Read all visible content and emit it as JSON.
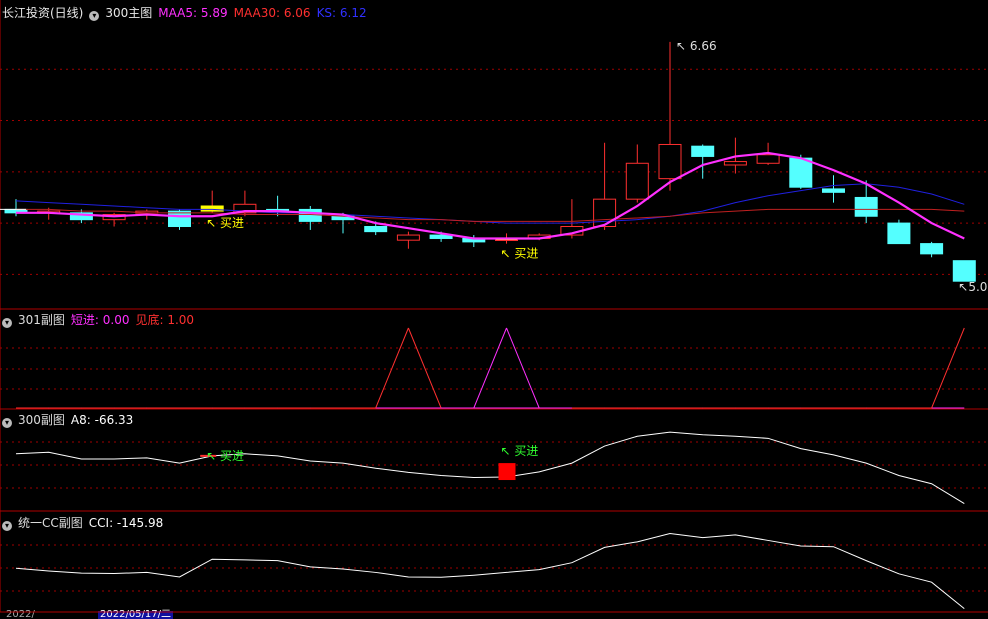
{
  "header": {
    "stock": "长江投资(日线)",
    "main_label": "300主图",
    "maa5": "MAA5: 5.89",
    "maa30": "MAA30: 6.06",
    "ks": "KS: 6.12"
  },
  "pane2": {
    "name": "301副图",
    "s1": "短进: 0.00",
    "s2": "见底: 1.00"
  },
  "pane3": {
    "name": "300副图",
    "s1": "A8: -66.33"
  },
  "pane4": {
    "name": "统一CC副图",
    "s1": "CCI: -145.98"
  },
  "bottom": {
    "left": "2022/",
    "date": "2022/05/17/二"
  },
  "colors": {
    "up": "#ff3030",
    "down": "#54ffff",
    "maa5": "#ff30ff",
    "maa30": "#c02020",
    "ks": "#2020e0",
    "grid": "#a00000",
    "yellow": "#ffff00"
  },
  "chart_data": [
    {
      "type": "candlestick",
      "title": "长江投资(日线)",
      "candles": [
        {
          "o": 5.68,
          "h": 5.74,
          "l": 5.64,
          "c": 5.66
        },
        {
          "o": 5.67,
          "h": 5.69,
          "l": 5.62,
          "c": 5.67
        },
        {
          "o": 5.66,
          "h": 5.68,
          "l": 5.6,
          "c": 5.62
        },
        {
          "o": 5.62,
          "h": 5.66,
          "l": 5.58,
          "c": 5.65
        },
        {
          "o": 5.66,
          "h": 5.68,
          "l": 5.62,
          "c": 5.67
        },
        {
          "o": 5.67,
          "h": 5.68,
          "l": 5.56,
          "c": 5.58
        },
        {
          "o": 5.67,
          "h": 5.79,
          "l": 5.66,
          "c": 5.7
        },
        {
          "o": 5.66,
          "h": 5.79,
          "l": 5.64,
          "c": 5.71
        },
        {
          "o": 5.68,
          "h": 5.76,
          "l": 5.64,
          "c": 5.67
        },
        {
          "o": 5.68,
          "h": 5.7,
          "l": 5.56,
          "c": 5.61
        },
        {
          "o": 5.64,
          "h": 5.66,
          "l": 5.54,
          "c": 5.62
        },
        {
          "o": 5.58,
          "h": 5.61,
          "l": 5.53,
          "c": 5.55
        },
        {
          "o": 5.5,
          "h": 5.55,
          "l": 5.45,
          "c": 5.53
        },
        {
          "o": 5.53,
          "h": 5.55,
          "l": 5.49,
          "c": 5.51
        },
        {
          "o": 5.51,
          "h": 5.53,
          "l": 5.46,
          "c": 5.49
        },
        {
          "o": 5.5,
          "h": 5.54,
          "l": 5.48,
          "c": 5.51
        },
        {
          "o": 5.51,
          "h": 5.54,
          "l": 5.5,
          "c": 5.53
        },
        {
          "o": 5.53,
          "h": 5.74,
          "l": 5.51,
          "c": 5.58
        },
        {
          "o": 5.58,
          "h": 6.07,
          "l": 5.56,
          "c": 5.74
        },
        {
          "o": 5.74,
          "h": 6.06,
          "l": 5.72,
          "c": 5.95
        },
        {
          "o": 5.86,
          "h": 6.66,
          "l": 5.79,
          "c": 6.06
        },
        {
          "o": 6.05,
          "h": 6.06,
          "l": 5.86,
          "c": 5.99
        },
        {
          "o": 5.94,
          "h": 6.1,
          "l": 5.89,
          "c": 5.96
        },
        {
          "o": 5.95,
          "h": 6.07,
          "l": 5.94,
          "c": 6.0
        },
        {
          "o": 5.98,
          "h": 6.0,
          "l": 5.8,
          "c": 5.81
        },
        {
          "o": 5.8,
          "h": 5.88,
          "l": 5.72,
          "c": 5.78
        },
        {
          "o": 5.75,
          "h": 5.85,
          "l": 5.6,
          "c": 5.64
        },
        {
          "o": 5.6,
          "h": 5.62,
          "l": 5.48,
          "c": 5.48
        },
        {
          "o": 5.48,
          "h": 5.49,
          "l": 5.4,
          "c": 5.42
        },
        {
          "o": 5.38,
          "h": 5.38,
          "l": 5.26,
          "c": 5.26
        }
      ],
      "maa5": [
        5.66,
        5.66,
        5.65,
        5.64,
        5.65,
        5.64,
        5.64,
        5.67,
        5.67,
        5.66,
        5.65,
        5.6,
        5.57,
        5.54,
        5.51,
        5.51,
        5.51,
        5.54,
        5.59,
        5.7,
        5.84,
        5.94,
        5.99,
        6.01,
        5.98,
        5.91,
        5.83,
        5.72,
        5.6,
        5.51
      ],
      "maa30": [
        5.68,
        5.68,
        5.67,
        5.67,
        5.66,
        5.66,
        5.66,
        5.65,
        5.65,
        5.65,
        5.64,
        5.63,
        5.62,
        5.62,
        5.61,
        5.61,
        5.61,
        5.61,
        5.62,
        5.63,
        5.64,
        5.66,
        5.67,
        5.68,
        5.68,
        5.68,
        5.68,
        5.68,
        5.68,
        5.67
      ],
      "ks": [
        5.73,
        5.72,
        5.71,
        5.7,
        5.69,
        5.68,
        5.68,
        5.67,
        5.66,
        5.66,
        5.65,
        5.64,
        5.63,
        5.62,
        5.61,
        5.6,
        5.6,
        5.6,
        5.61,
        5.62,
        5.64,
        5.67,
        5.72,
        5.76,
        5.79,
        5.82,
        5.83,
        5.81,
        5.77,
        5.71
      ],
      "annotations": [
        {
          "text": "6.66",
          "index": 20
        },
        {
          "text": "5.0",
          "index": 29
        },
        {
          "text": "买进",
          "index": 6
        },
        {
          "text": "买进",
          "index": 15
        }
      ]
    },
    {
      "type": "line",
      "title": "301副图",
      "ylim": [
        0,
        1
      ],
      "series": [
        {
          "name": "短进",
          "values": [
            0,
            0,
            0,
            0,
            0,
            0,
            0,
            0,
            0,
            0,
            0,
            0,
            0,
            0,
            0,
            0,
            0,
            0,
            0,
            0,
            0,
            0,
            0,
            0,
            0,
            0,
            0,
            0,
            0,
            0
          ]
        },
        {
          "name": "见底",
          "values": [
            0,
            0,
            0,
            0,
            0,
            0,
            0,
            0,
            0,
            0,
            0,
            0,
            1,
            0,
            0,
            1,
            0,
            0,
            0,
            0,
            0,
            0,
            0,
            0,
            0,
            0,
            0,
            0,
            0,
            1
          ]
        }
      ]
    },
    {
      "type": "line",
      "title": "300副图",
      "series": [
        {
          "name": "A8",
          "values": [
            30,
            33,
            20,
            20,
            22,
            12,
            26,
            30,
            26,
            16,
            12,
            2,
            -6,
            -12,
            -16,
            -15,
            -5,
            12,
            45,
            64,
            72,
            67,
            64,
            60,
            40,
            28,
            12,
            -12,
            -28,
            -66.33
          ]
        }
      ],
      "annotations": [
        {
          "text": "买进",
          "index": 6
        },
        {
          "text": "买进",
          "index": 15
        }
      ]
    },
    {
      "type": "line",
      "title": "统一CC副图",
      "series": [
        {
          "name": "CCI",
          "values": [
            -30,
            -38,
            -44,
            -45,
            -42,
            -55,
            -4,
            -6,
            -8,
            -26,
            -32,
            -42,
            -55,
            -56,
            -50,
            -42,
            -34,
            -14,
            30,
            46,
            70,
            58,
            66,
            50,
            34,
            32,
            -8,
            -46,
            -70,
            -145.98
          ]
        }
      ]
    }
  ]
}
